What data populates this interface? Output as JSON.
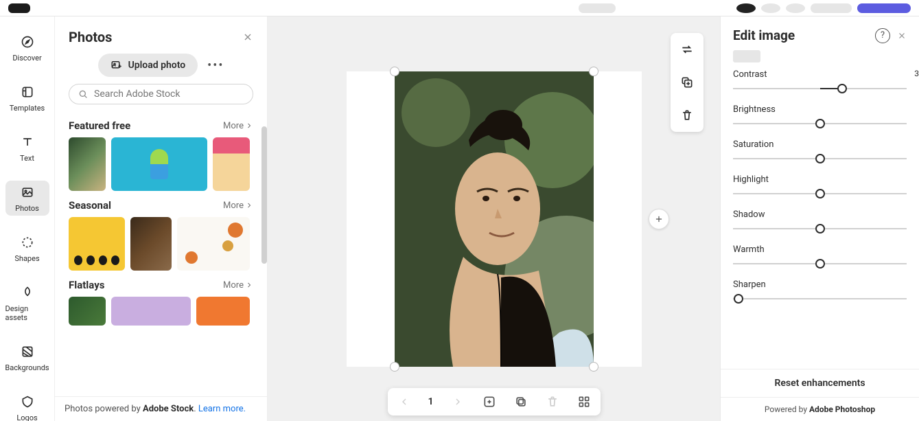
{
  "rail": {
    "items": [
      {
        "id": "discover",
        "label": "Discover"
      },
      {
        "id": "templates",
        "label": "Templates"
      },
      {
        "id": "text",
        "label": "Text"
      },
      {
        "id": "photos",
        "label": "Photos",
        "active": true
      },
      {
        "id": "shapes",
        "label": "Shapes"
      },
      {
        "id": "designassets",
        "label": "Design assets"
      },
      {
        "id": "backgrounds",
        "label": "Backgrounds"
      },
      {
        "id": "logos",
        "label": "Logos"
      }
    ]
  },
  "photos_panel": {
    "title": "Photos",
    "upload_label": "Upload photo",
    "search_placeholder": "Search Adobe Stock",
    "sections": [
      {
        "title": "Featured free",
        "more": "More"
      },
      {
        "title": "Seasonal",
        "more": "More"
      },
      {
        "title": "Flatlays",
        "more": "More"
      }
    ],
    "powered_prefix": "Photos powered by ",
    "powered_brand": "Adobe Stock",
    "powered_suffix": ". ",
    "learn_more": "Learn more."
  },
  "canvas": {
    "page": "1"
  },
  "edit_panel": {
    "title": "Edit image",
    "contrast": {
      "label": "Contrast",
      "value": "3",
      "pos": 63
    },
    "brightness": {
      "label": "Brightness",
      "pos": 50
    },
    "saturation": {
      "label": "Saturation",
      "pos": 50
    },
    "highlight": {
      "label": "Highlight",
      "pos": 50
    },
    "shadow": {
      "label": "Shadow",
      "pos": 50
    },
    "warmth": {
      "label": "Warmth",
      "pos": 50
    },
    "sharpen": {
      "label": "Sharpen",
      "pos": 3
    },
    "reset": "Reset enhancements",
    "powered_prefix": "Powered by ",
    "powered_brand": "Adobe Photoshop"
  }
}
